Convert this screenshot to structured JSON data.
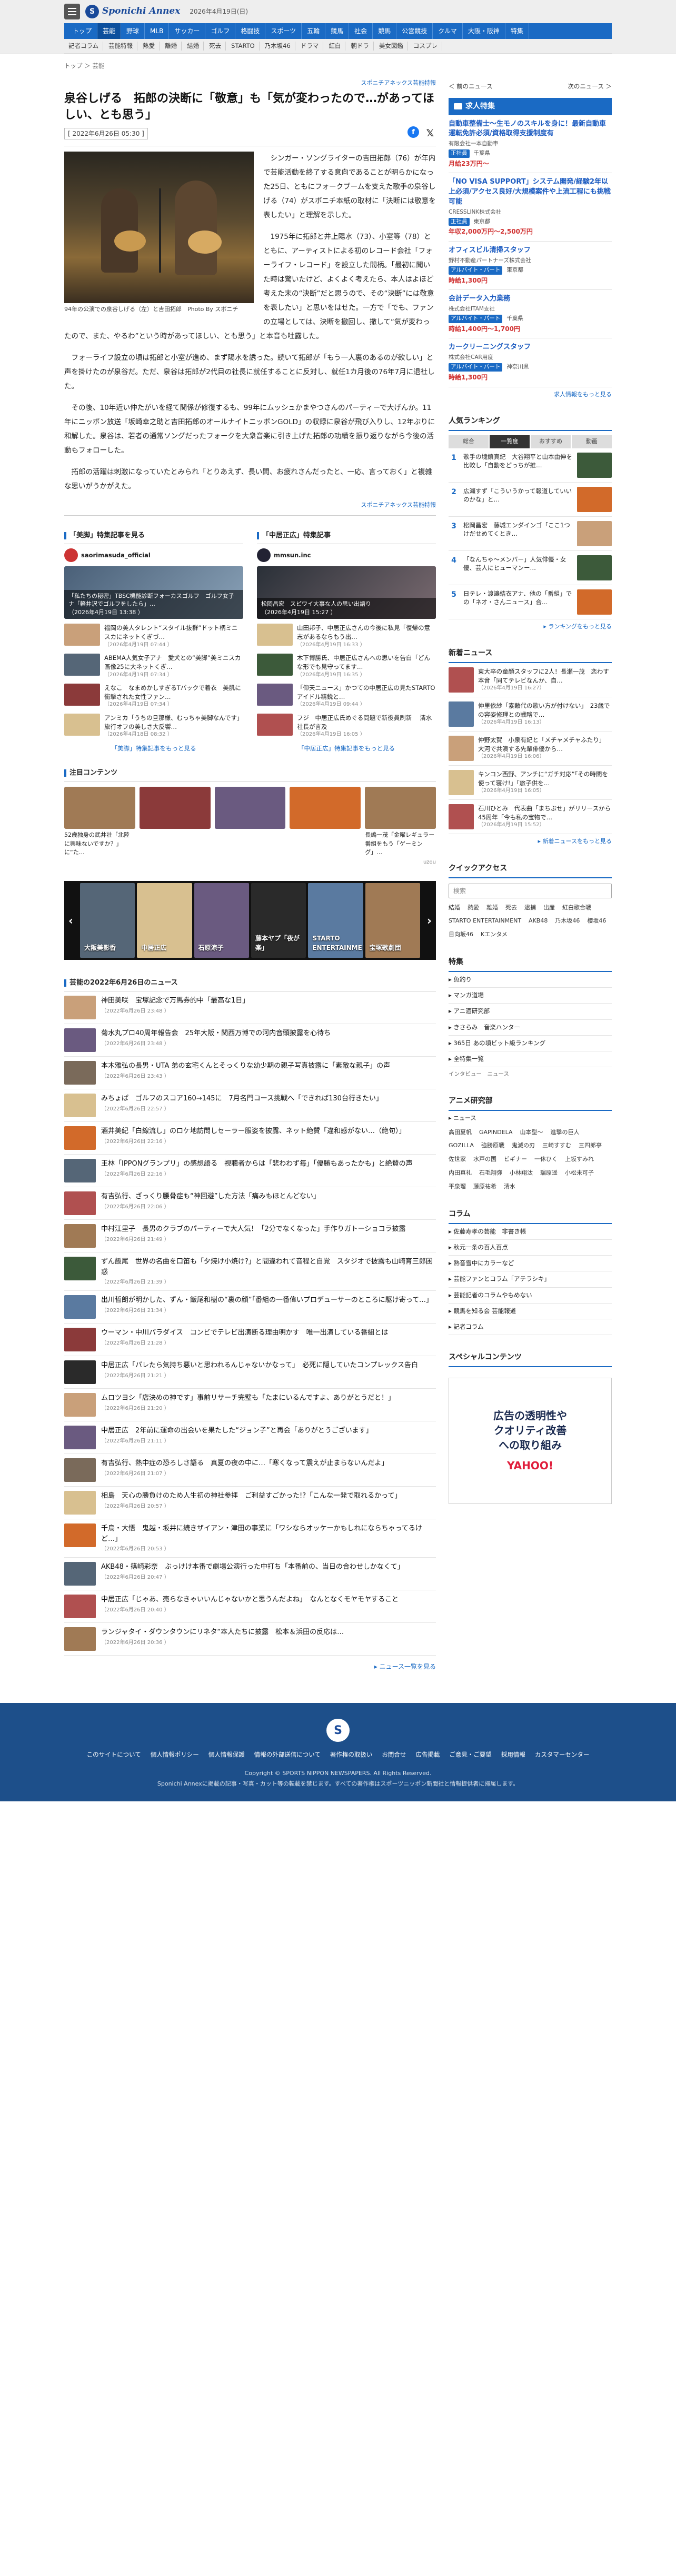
{
  "header": {
    "logo_letter": "S",
    "logo_text": "Sponichi Annex",
    "date": "2026年4月19日(日)",
    "nav1": [
      "トップ",
      "芸能",
      "野球",
      "MLB",
      "サッカー",
      "ゴルフ",
      "格闘技",
      "スポーツ",
      "五輪",
      "競馬",
      "社会",
      "競馬",
      "公営競技",
      "クルマ",
      "大阪・阪神",
      "特集"
    ],
    "nav2": [
      "記者コラム",
      "芸能特報",
      "熱愛",
      "離婚",
      "結婚",
      "死去",
      "STARTO",
      "乃木坂46",
      "ドラマ",
      "紅白",
      "朝ドラ",
      "美女図鑑",
      "コスプレ"
    ]
  },
  "crumbs": [
    "トップ",
    "＞",
    "芸能"
  ],
  "pager": {
    "prev": "＜ 前のニュース",
    "next": "次のニュース ＞"
  },
  "article": {
    "source": "スポニチアネックス芸能特報",
    "title": "泉谷しげる　拓郎の決断に「敬意」も「気が変わったので…があってほしい、とも思う」",
    "date": "[ 2022年6月26日 05:30 ]",
    "photo_caption": "94年の公演での泉谷しげる（左）と吉田拓郎　Photo By スポニチ",
    "paragraphs": [
      "シンガー・ソングライターの吉田拓郎（76）が年内で芸能活動を終了する意向であることが明らかになった25日、ともにフォークブームを支えた歌手の泉谷しげる（74）がスポニチ本紙の取材に「決断には敬意を表したい」と理解を示した。",
      "1975年に拓郎と井上陽水（73）、小室等（78）とともに、アーティストによる初のレコード会社「フォーライフ・レコード」を設立した間柄。「最初に聞いた時は驚いたけど、よくよく考えたら、本人はよほど考えた末の“決断”だと思うので、その“決断”には敬意を表したい」と思いをはせた。一方で「でも、ファンの立場としては、決断を撤回し、撤して“気が変わったので、また、やるわ”という時があってほしい、とも思う」と本音も吐露した。",
      "フォーライフ設立の頃は拓郎と小室が進め、まず陽水を誘った。続いて拓郎が「もう一人裏のあるのが欲しい」と声を掛けたのが泉谷だ。ただ、泉谷は拓郎が2代目の社長に就任することに反対し、就任1カ月後の76年7月に退社した。",
      "その後、10年近い仲たがいを経て関係が修復するも、99年にムッシュかまやつさんのパーティーで大げんか。11年にニッポン放送「坂崎幸之助と吉田拓郎のオールナイトニッポンGOLD」の収録に泉谷が飛び入りし、12年ぶりに和解した。泉谷は、若者の通常ソングだったフォークを大衆音楽に引き上げた拓郎の功績を振り返りながら今後の活動もフォローした。",
      "拓郎の活躍は刺激になっていたとみられ「とりあえず、長い間、お疲れさんだったと、一応、言っておく」と複雑な思いがうかがえた。"
    ],
    "source_bottom": "スポニチアネックス芸能特報"
  },
  "features": {
    "left_head": "「美脚」特集記事を見る",
    "right_head": "「中居正広」特集記事",
    "left_profile": "saorimasuda_official",
    "right_profile": "mmsun.inc",
    "left_main": "「私たちの秘密」TBSC機能診断フォーカスゴルフ　ゴルフ女子ナ「軽井沢でゴルフをしたら」…",
    "left_main_date": "（2026年4月19日 13:38 ）",
    "right_main": "松岡昌宏　スピワイ大事な人の思い出語り",
    "right_main_date": "（2026年4月19日 15:27 ）",
    "left_items": [
      {
        "t": "福岡の美人タレント“スタイル抜群”ドット柄ミニスカにネットくぎづ…",
        "d": "（2026年4月19日 07:44 ）"
      },
      {
        "t": "ABEMA人気女子アナ　愛犬との“美脚”美ミニスカ画像25に大ネットくぎ…",
        "d": "（2026年4月19日 07:34 ）"
      },
      {
        "t": "えなこ　なまめかしすぎるTバックで着衣　美肌に衝撃された女性ファン…",
        "d": "（2026年4月19日 07:34 ）"
      },
      {
        "t": "アンミカ「うちの旦那様、むっちゃ美脚なんです」旅行オフの美しさ大反響…",
        "d": "（2026年4月18日 08:32 ）"
      }
    ],
    "right_items": [
      {
        "t": "山田邦子、中居正広さんの今後に私見「復帰の意志があるならもう出…",
        "d": "（2026年4月19日 16:33 ）"
      },
      {
        "t": "木下博勝氏、中居正広さんへの思いを告白「どんな形でも見守ってます…",
        "d": "（2026年4月19日 16:35 ）"
      },
      {
        "t": "「仰天ニュース」かつての中居正広の見たSTARTOアイドル精鋭と…",
        "d": "（2026年4月19日 09:44 ）"
      },
      {
        "t": "フジ　中居正広氏めぐる問題で新役員刷新 　清水社長が言及",
        "d": "（2026年4月19日 16:05 ）"
      }
    ],
    "left_more": "「美脚」特集記事をもっと見る",
    "right_more": "「中居正広」特集記事をもっと見る"
  },
  "notable": {
    "head": "注目コンテンツ",
    "cards": [
      "52歳独身の武井壮「北陸に興味ないですか？」に“た…",
      "",
      "",
      "",
      "長嶋一茂「金曜レギュラー番組をもう「ゲーミング」…"
    ],
    "ad_label": "uzou"
  },
  "slider": {
    "slides": [
      "大阪美影香",
      "中居正広",
      "石原涼子",
      "藤本ヤプ「夜が楽」",
      "STARTO ENTERTAINMENT",
      "宝塚歌劇団"
    ],
    "prev": "‹",
    "next": "›"
  },
  "daily": {
    "head": "芸能の2022年6月26日のニュース",
    "items": [
      {
        "t": "神田美咲　宝塚記念で万馬券的中「最高な1日」",
        "d": "（2022年6月26日 23:48 ）"
      },
      {
        "t": "菊水丸プロ40周年報告会　25年大阪・関西万博での河内音頭披露を心待ち",
        "d": "（2022年6月26日 23:48 ）"
      },
      {
        "t": "本木雅弘の長男・UTA 弟の玄宅くんとそっくりな幼少期の親子写真披露に「素敵な親子」の声",
        "d": "（2022年6月26日 23:43 ）"
      },
      {
        "t": "みちょぱ　ゴルフのスコア160→145に　7月名門コース挑戦へ「できれば130台行きたい」",
        "d": "（2022年6月26日 22:57 ）"
      },
      {
        "t": "酒井美紀「白線流し」のロケ地訪問しセーラー服姿を披露、ネット絶賛「違和感がない…（絶句）」",
        "d": "（2022年6月26日 22:16 ）"
      },
      {
        "t": "王林「IPPONグランプリ」の感想語る　視聴者からは「悲わわず毎」「優勝もあったかも」と絶賛の声",
        "d": "（2022年6月26日 22:16 ）"
      },
      {
        "t": "有吉弘行、ざっくり腰骨症も“神回避”した方法「痛みもほとんどない」",
        "d": "（2022年6月26日 22:06 ）"
      },
      {
        "t": "中村江里子　長男のクラブのパーティーで大人気！「2分でなくなった」手作りガトーショコラ披露",
        "d": "（2022年6月26日 21:49 ）"
      },
      {
        "t": "ずん飯尾　世界の名曲を口笛も「夕焼け小焼け?」と間違われて音程と自覚　スタジオで披露も山崎育三郎困惑",
        "d": "（2022年6月26日 21:39 ）"
      },
      {
        "t": "出川哲朗が明かした、ずん・飯尾和樹の“裏の顔”「番組の一番偉いプロデューサーのところに駆け寄って…」",
        "d": "（2022年6月26日 21:34 ）"
      },
      {
        "t": "ウーマン・中川パラダイス　コンビでテレビ出演断る理由明かす　唯一出演している番組とは",
        "d": "（2022年6月26日 21:28 ）"
      },
      {
        "t": "中居正広「パレたら気持ち悪いと思われるんじゃないかなって」　必死に隠していたコンプレックス告白",
        "d": "（2022年6月26日 21:21 ）"
      },
      {
        "t": "ムロツヨシ「店決めの神です」事前リサーチ完璧も「たまにいるんですよ、ありがとうだと！」",
        "d": "（2022年6月26日 21:20 ）"
      },
      {
        "t": "中居正広　2年前に運命の出会いを果たした“ジョン子”と再会「ありがとうございます」",
        "d": "（2022年6月26日 21:11 ）"
      },
      {
        "t": "有吉弘行、熱中症の恐ろしさ語る　真夏の夜の中に…「寒くなって震えが止まらないんだよ」",
        "d": "（2022年6月26日 21:07 ）"
      },
      {
        "t": "相島　天心の勝負けのため人生初の神社参拝　ご利益すごかった!?「こんな一発で取れるかって」",
        "d": "（2022年6月26日 20:57 ）"
      },
      {
        "t": "千鳥・大悟　鬼越・坂井に続きザイアン・津田の事業に「ワシならオッケーかもしれにならちゃってるけど…」",
        "d": "（2022年6月26日 20:53 ）"
      },
      {
        "t": "AKB48・篠崎彩奈　ぶっけけ本番で劇場公演行った中打ち「本番前の、当日の合わせしかなくて」",
        "d": "（2022年6月26日 20:47 ）"
      },
      {
        "t": "中居正広「じゃあ、売らなきゃいいんじゃないかと思うんだよね」　なんとなくモヤモヤすること",
        "d": "（2022年6月26日 20:40 ）"
      },
      {
        "t": "ランジャタイ・ダウンタウンにリネタ“本人たちに披露　松本＆浜田の反応は…",
        "d": "（2022年6月26日 20:36 ）"
      }
    ],
    "all": "▸ ニュース一覧を見る"
  },
  "jobs": {
    "head": "求人特集",
    "items": [
      {
        "t": "自動車整備士〜生モノのスキルを身に！最新自動車運転免許必須/資格取得支援制度有",
        "c": "有限会社一本自動車",
        "l": "正社員",
        "p": "千葉県",
        "w": "月給23万円〜"
      },
      {
        "t": "「NO VISA SUPPORT」システム開発/経験2年以上必須/アクセス良好/大規模案件や上流工程にも挑戦可能",
        "c": "CRESSLINK株式会社",
        "l": "正社員",
        "p": "東京都",
        "w": "年収2,000万円〜2,500万円"
      },
      {
        "t": "オフィスビル清掃スタッフ",
        "c": "野村不動産パートナーズ株式会社",
        "l": "アルバイト・パート",
        "p": "東京都",
        "w": "時給1,300円"
      },
      {
        "t": "会計データ入力業務",
        "c": "株式会社ITAM支社",
        "l": "アルバイト・パート",
        "p": "千葉県",
        "w": "時給1,400円〜1,700円"
      },
      {
        "t": "カークリーニングスタッフ",
        "c": "株式会社CAR用度",
        "l": "アルバイト・パート",
        "p": "神奈川県",
        "w": "時給1,300円"
      }
    ],
    "more": "求人情報をもっと見る"
  },
  "ranking": {
    "head": "人気ランキング",
    "tabs": [
      "総合",
      "一覧度",
      "おすすめ",
      "動画"
    ],
    "items": [
      {
        "n": "1",
        "t": "歌手の塊鎮真紀　大谷翔平と山本由伸を比較し「自動をどっちが推…"
      },
      {
        "n": "2",
        "t": "広瀬すず「こういうかって報道していいのかな」と…"
      },
      {
        "n": "3",
        "t": "松岡昌宏　藤城エンダインゴ「ここ1つけだせめてくとき…"
      },
      {
        "n": "4",
        "t": "「なんちゃ〜メンバー」人気俳優・女優、芸人にヒューマンー…"
      },
      {
        "n": "5",
        "t": "日テレ・渡邉結衣アナ、他の「番組」での「ネオ・さんニュース」合…"
      }
    ],
    "more": "▸ ランキングをもっと見る"
  },
  "latest": {
    "head": "新着ニュース",
    "items": [
      {
        "t": "東大卒の童顔スタッフに2人！長瀬一茂　恋わす本音「同てテレビなんか、自…",
        "d": "（2026年4月19日 16:27）"
      },
      {
        "t": "仲里依紗「素敵代の歌い方が付けない」　23歳での容姿修理との戦略で…",
        "d": "（2026年4月19日 16:13）"
      },
      {
        "t": "仲野太賀　小泉有紀と「メチャメチャふたり」 大河で共演する先輩俳優から…",
        "d": "（2026年4月19日 16:06）"
      },
      {
        "t": "キンコン西野、アンチに“ガチ対応”「その時間を使って寝け!」「旅子供を…",
        "d": "（2026年4月19日 16:05）"
      },
      {
        "t": "石川ひとみ　代表曲「まちぶせ」がリリースから45周年「今も私の宝物で…",
        "d": "（2026年4月19日 15:52）"
      }
    ],
    "more": "▸ 新着ニュースをもっと見る"
  },
  "quick": {
    "head": "クイックアクセス",
    "placeholder": "検索",
    "tags": [
      "結婚",
      "熱愛",
      "離婚",
      "死去",
      "逮捕",
      "出産",
      "紅白歌合戦",
      "STARTO ENTERTAINMENT",
      "AKB48",
      "乃木坂46",
      "櫻坂46",
      "日向坂46",
      "Kエンタメ"
    ]
  },
  "tokushu": {
    "head": "特集",
    "items": [
      "▸ 魚釣り",
      "▸ マンガ道場",
      "▸ アニ酒研究部",
      "▸ きさらみ　音楽ハンター",
      "▸ 365日 あの頃ビット級ランキング",
      "▸ 全特集一覧"
    ],
    "sub": "インタビュー　ニュース"
  },
  "anime": {
    "head": "アニメ研究部",
    "sub": "▸ ニュース",
    "tags": [
      "高田夏帆",
      "GAPINDELA",
      "山本型〜",
      "進撃の巨人",
      "GOZILLA",
      "強勝原戦",
      "鬼滅の刃",
      "三崎すすむ",
      "三四郎亭",
      "佐世家",
      "水戸の国",
      "ビギナー",
      "一休ひく",
      "上坂すみれ",
      "内田真礼",
      "石毛翔弥",
      "小林翔汰",
      "瑞原遥",
      "小松未可子",
      "平泉瑠",
      "藤原祐希",
      "清水"
    ]
  },
  "column": {
    "head": "コラム",
    "items": [
      "▸ 佐藤寿孝の芸能　非書き帳",
      "▸ 秋元一条の百人百点",
      "▸ 熟音雪中にカラーなど",
      "▸ 芸能ファンとコラム「アテラシキ」",
      "▸ 芸能記者のコラムやもめない",
      "▸ 競馬を知る会 芸能報道",
      "▸ 記者コラム"
    ]
  },
  "special": {
    "head": "スペシャルコンテンツ",
    "ad_line1": "広告の透明性や",
    "ad_line2": "クオリティ改善",
    "ad_line3": "への取り組み",
    "ad_brand": "YAHOO!"
  },
  "footer": {
    "logo": "S",
    "links": [
      "このサイトについて",
      "個人情報ポリシー",
      "個人情報保護",
      "情報の外部送信について",
      "著作権の取扱い",
      "お問合せ",
      "広告掲載",
      "ご意見・ご要望",
      "採用情報",
      "カスタマーセンター"
    ],
    "copy": "Copyright © SPORTS NIPPON NEWSPAPERS. All Rights Reserved.",
    "copy2": "Sponichi Annexに掲載の記事・写真・カット等の転載を禁じます。すべての著作権はスポーツニッポン新聞社と情報提供者に帰属します。"
  }
}
